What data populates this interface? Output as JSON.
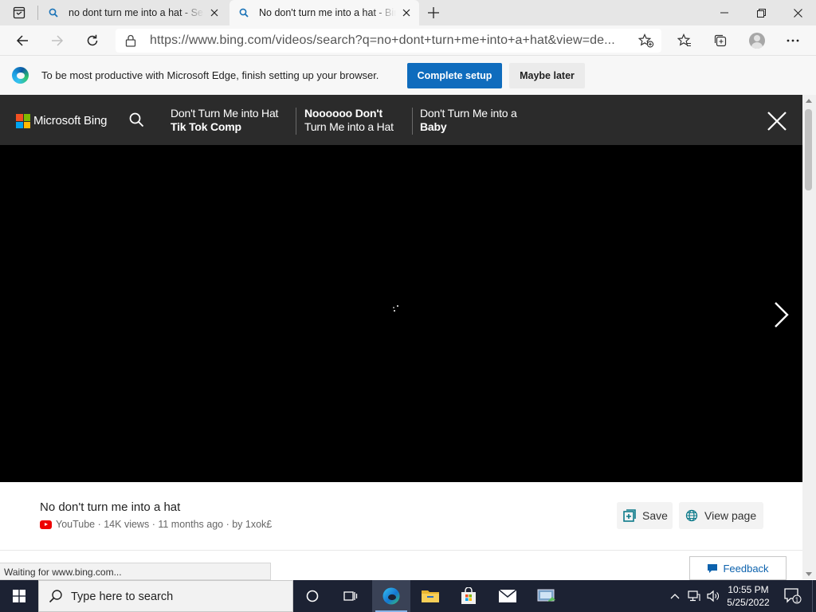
{
  "browser": {
    "tabs": [
      {
        "title": "no dont turn me into a hat - Search",
        "active": false
      },
      {
        "title": "No don't turn me into a hat - Bing",
        "active": true
      }
    ],
    "url": "https://www.bing.com/videos/search?q=no+dont+turn+me+into+a+hat&view=de...",
    "status_text": "Waiting for www.bing.com..."
  },
  "setup_bar": {
    "message": "To be most productive with Microsoft Edge, finish setting up your browser.",
    "complete_label": "Complete setup",
    "later_label": "Maybe later"
  },
  "bing": {
    "brand": "Microsoft Bing",
    "logo_colors": [
      "#f25022",
      "#7fba00",
      "#00a4ef",
      "#ffb900"
    ],
    "related": [
      {
        "line1": "Don't Turn Me into Hat",
        "line2": "Tik Tok Comp",
        "bold_line": 2
      },
      {
        "line1": "Noooooo Don't",
        "line2": "Turn Me into a Hat",
        "bold_line": 1
      },
      {
        "line1": "Don't Turn Me into a",
        "line2": "Baby",
        "bold_line": 2
      }
    ]
  },
  "video": {
    "title": "No don't turn me into a hat",
    "source": "YouTube",
    "views": "14K views",
    "age": "11 months ago",
    "author": "by 1xok£",
    "save_label": "Save",
    "view_page_label": "View page",
    "feedback_label": "Feedback"
  },
  "taskbar": {
    "search_placeholder": "Type here to search",
    "time": "10:55 PM",
    "date": "5/25/2022",
    "notification_count": "1"
  }
}
